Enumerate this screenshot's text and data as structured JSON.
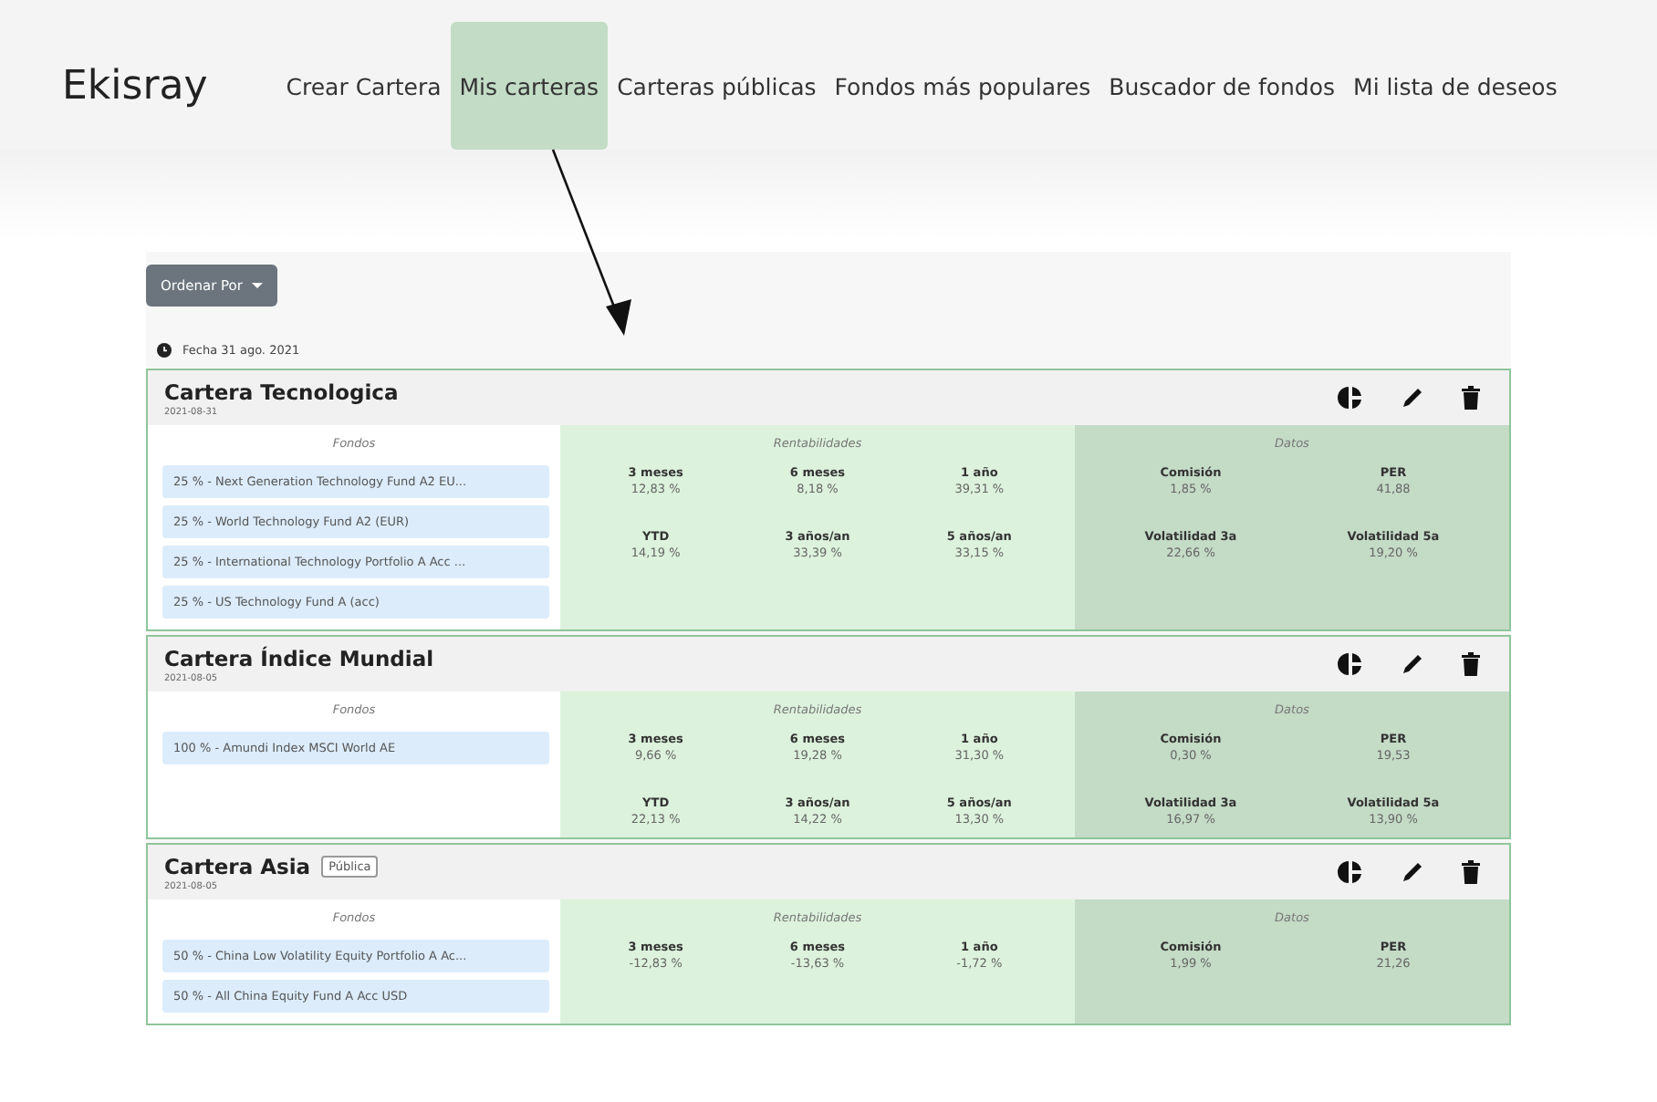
{
  "nav": {
    "brand": "Ekisray",
    "items": [
      {
        "label": "Crear Cartera",
        "selected": false
      },
      {
        "label": "Mis carteras",
        "selected": true
      },
      {
        "label": "Carteras públicas",
        "selected": false
      },
      {
        "label": "Fondos más populares",
        "selected": false
      },
      {
        "label": "Buscador de fondos",
        "selected": false
      },
      {
        "label": "Mi lista de deseos",
        "selected": false
      }
    ]
  },
  "sort_button": {
    "label": "Ordenar Por"
  },
  "date_label": "Fecha 31 ago. 2021",
  "portfolios": [
    {
      "name": "Cartera Tecnologica",
      "date": "2021-08-31",
      "funds_header": "Fondos",
      "funds": [
        "25 % - Next Generation Technology Fund A2 EU...",
        "25 % - World Technology Fund A2 (EUR)",
        "25 % - International Technology Portfolio A Acc ...",
        "25 % - US Technology Fund A (acc)"
      ],
      "returns_header": "Rentabilidades",
      "returns": [
        {
          "label": "3 meses",
          "value": "12,83 %"
        },
        {
          "label": "6 meses",
          "value": "8,18 %"
        },
        {
          "label": "1 año",
          "value": "39,31 %"
        },
        {
          "label": "YTD",
          "value": "14,19 %"
        },
        {
          "label": "3 años/an",
          "value": "33,39 %"
        },
        {
          "label": "5 años/an",
          "value": "33,15 %"
        }
      ],
      "data_header": "Datos",
      "data": [
        {
          "label": "Comisión",
          "value": "1,85 %"
        },
        {
          "label": "PER",
          "value": "41,88"
        },
        {
          "label": "Volatilidad 3a",
          "value": "22,66 %"
        },
        {
          "label": "Volatilidad 5a",
          "value": "19,20 %"
        }
      ]
    },
    {
      "name": "Cartera Índice Mundial",
      "date": "2021-08-05",
      "funds_header": "Fondos",
      "funds": [
        "100 % - Amundi Index MSCI World AE"
      ],
      "returns_header": "Rentabilidades",
      "returns": [
        {
          "label": "3 meses",
          "value": "9,66 %"
        },
        {
          "label": "6 meses",
          "value": "19,28 %"
        },
        {
          "label": "1 año",
          "value": "31,30 %"
        },
        {
          "label": "YTD",
          "value": "22,13 %"
        },
        {
          "label": "3 años/an",
          "value": "14,22 %"
        },
        {
          "label": "5 años/an",
          "value": "13,30 %"
        }
      ],
      "data_header": "Datos",
      "data": [
        {
          "label": "Comisión",
          "value": "0,30 %"
        },
        {
          "label": "PER",
          "value": "19,53"
        },
        {
          "label": "Volatilidad 3a",
          "value": "16,97 %"
        },
        {
          "label": "Volatilidad 5a",
          "value": "13,90 %"
        }
      ]
    },
    {
      "name": "Cartera Asia",
      "badge": "Pública",
      "date": "2021-08-05",
      "funds_header": "Fondos",
      "funds": [
        "50 % - China Low Volatility Equity Portfolio A Ac...",
        "50 % - All China Equity Fund A Acc USD"
      ],
      "returns_header": "Rentabilidades",
      "returns": [
        {
          "label": "3 meses",
          "value": "-12,83 %"
        },
        {
          "label": "6 meses",
          "value": "-13,63 %"
        },
        {
          "label": "1 año",
          "value": "-1,72 %"
        }
      ],
      "data_header": "Datos",
      "data": [
        {
          "label": "Comisión",
          "value": "1,99 %"
        },
        {
          "label": "PER",
          "value": "21,26"
        }
      ]
    }
  ]
}
